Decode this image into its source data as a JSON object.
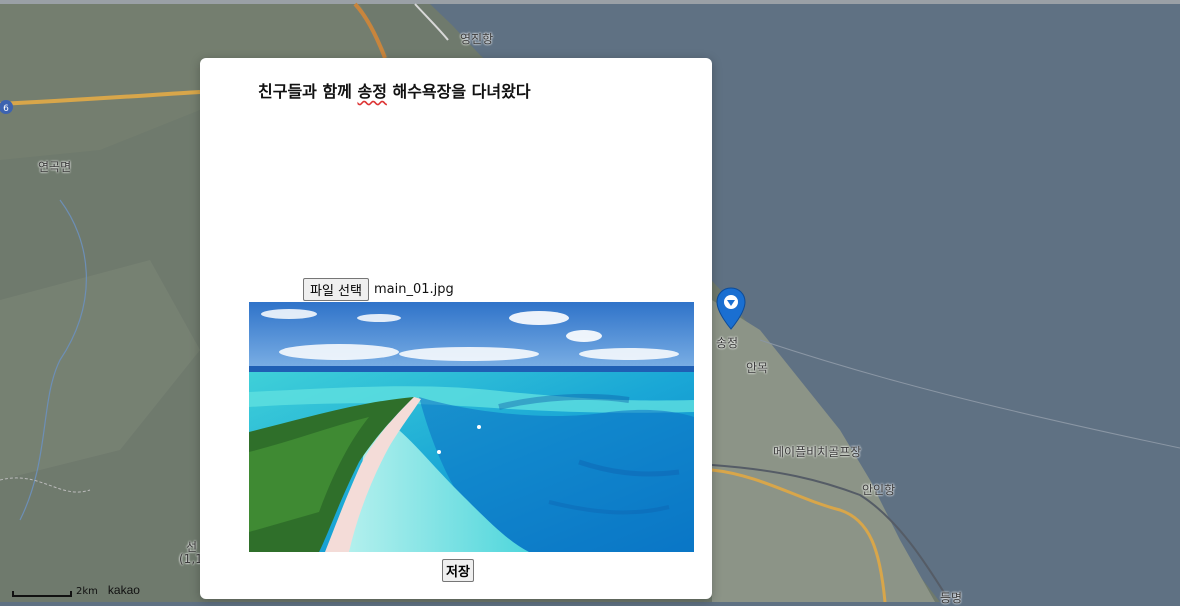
{
  "map": {
    "labels": {
      "yeongjin": "영진항",
      "yeongok": "연곡면",
      "songjeong": "송정",
      "anmok": "안목",
      "golf": "메이플비치골프장",
      "anin": "안인항",
      "bottom_left": "선",
      "bottom_left2": "(1,1",
      "bottom_right": "등명",
      "road_number": "6"
    },
    "scale_text": "2km",
    "brand": "kakao"
  },
  "modal": {
    "title_before": "친구들과 함께 ",
    "title_mark": "송정",
    "title_after": " 해수욕장을 다녀왔다",
    "file_button_label": "파일 선택",
    "file_name": "main_01.jpg",
    "save_label": "저장"
  },
  "colors": {
    "sea": "#5f7183",
    "marker": "#1a6fd1"
  }
}
